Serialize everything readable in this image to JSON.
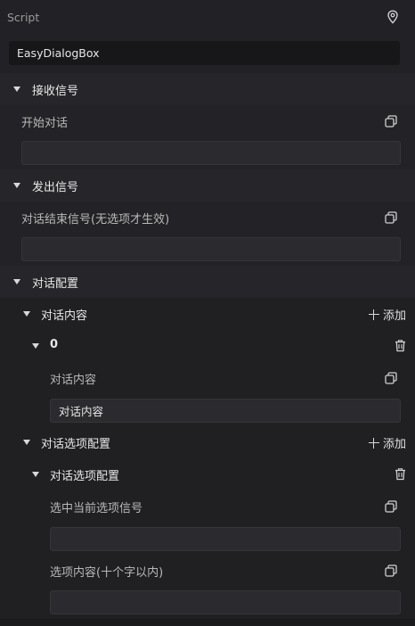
{
  "inspector": {
    "component_label": "Script",
    "script_name": "EasyDialogBox",
    "sections": {
      "receive": {
        "title": "接收信号",
        "prop_label": "开始对话",
        "value": ""
      },
      "emit": {
        "title": "发出信号",
        "prop_label": "对话结束信号(无选项才生效)",
        "value": ""
      },
      "config": {
        "title": "对话配置",
        "content_group": {
          "title": "对话内容",
          "add_label": "添加",
          "item": {
            "index": "0",
            "prop_label": "对话内容",
            "value": "对话内容"
          }
        },
        "options_group": {
          "title": "对话选项配置",
          "add_label": "添加",
          "item": {
            "title": "对话选项配置",
            "signal_label": "选中当前选项信号",
            "signal_value": "",
            "content_label": "选项内容(十个字以内)",
            "content_value": ""
          }
        }
      }
    }
  },
  "icons": {
    "pin": "map-pin-icon",
    "copy": "copy-icon",
    "add": "plus-icon",
    "trash": "trash-icon",
    "collapse": "triangle-down-icon"
  }
}
